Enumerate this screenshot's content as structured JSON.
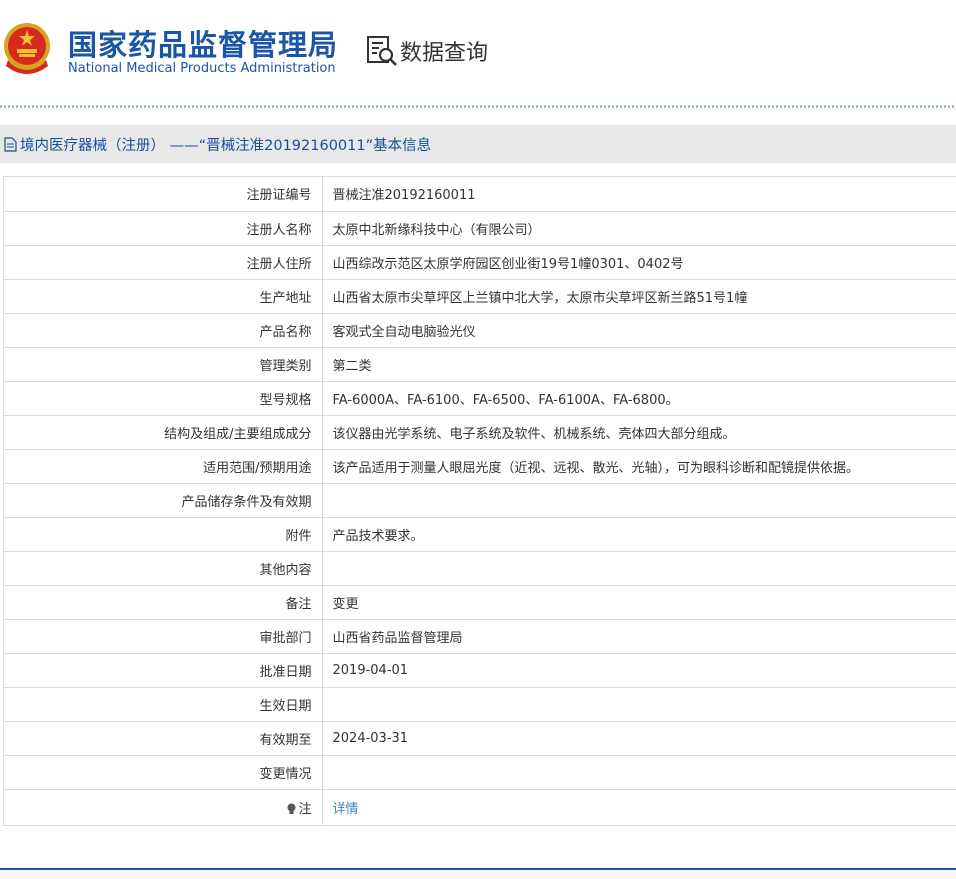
{
  "header": {
    "title_cn": "国家药品监督管理局",
    "title_en": "National Medical Products Administration",
    "query_label": "数据查询",
    "brand_color": "#1a55a8"
  },
  "section": {
    "title": "境内医疗器械（注册） ——“晋械注准20192160011”基本信息"
  },
  "rows": [
    {
      "label": "注册证编号",
      "value": "晋械注准20192160011"
    },
    {
      "label": "注册人名称",
      "value": "太原中北新缘科技中心（有限公司）"
    },
    {
      "label": "注册人住所",
      "value": "山西综改示范区太原学府园区创业街19号1幢0301、0402号"
    },
    {
      "label": "生产地址",
      "value": "山西省太原市尖草坪区上兰镇中北大学，太原市尖草坪区新兰路51号1幢"
    },
    {
      "label": "产品名称",
      "value": "客观式全自动电脑验光仪"
    },
    {
      "label": "管理类别",
      "value": "第二类"
    },
    {
      "label": "型号规格",
      "value": "FA-6000A、FA-6100、FA-6500、FA-6100A、FA-6800。"
    },
    {
      "label": "结构及组成/主要组成成分",
      "value": "该仪器由光学系统、电子系统及软件、机械系统、壳体四大部分组成。"
    },
    {
      "label": "适用范围/预期用途",
      "value": "该产品适用于测量人眼屈光度（近视、远视、散光、光轴），可为眼科诊断和配镜提供依据。"
    },
    {
      "label": "产品储存条件及有效期",
      "value": ""
    },
    {
      "label": "附件",
      "value": "产品技术要求。"
    },
    {
      "label": "其他内容",
      "value": ""
    },
    {
      "label": "备注",
      "value": "变更"
    },
    {
      "label": "审批部门",
      "value": "山西省药品监督管理局"
    },
    {
      "label": "批准日期",
      "value": "2019-04-01"
    },
    {
      "label": "生效日期",
      "value": ""
    },
    {
      "label": "有效期至",
      "value": "2024-03-31"
    },
    {
      "label": "变更情况",
      "value": ""
    }
  ],
  "note": {
    "label": "注",
    "icon": "lightbulb-icon",
    "link_text": "详情",
    "link_color": "#3b7fcf"
  }
}
